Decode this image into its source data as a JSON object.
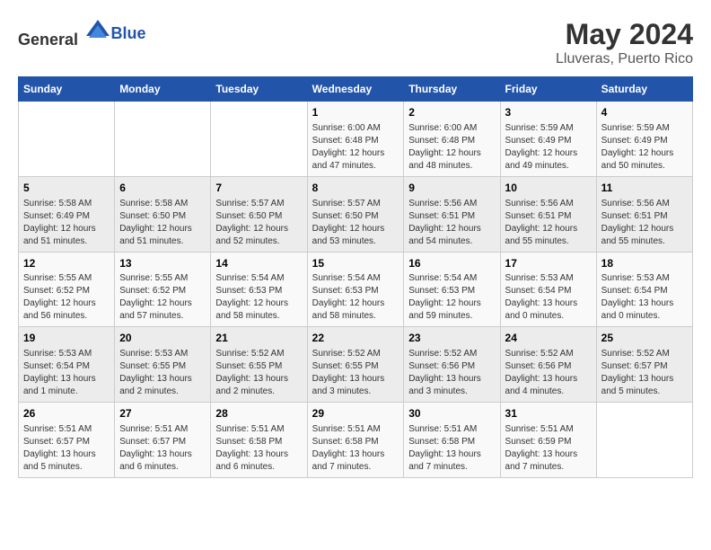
{
  "logo": {
    "general": "General",
    "blue": "Blue"
  },
  "title": "May 2024",
  "subtitle": "Lluveras, Puerto Rico",
  "weekdays": [
    "Sunday",
    "Monday",
    "Tuesday",
    "Wednesday",
    "Thursday",
    "Friday",
    "Saturday"
  ],
  "weeks": [
    [
      {
        "day": "",
        "info": ""
      },
      {
        "day": "",
        "info": ""
      },
      {
        "day": "",
        "info": ""
      },
      {
        "day": "1",
        "info": "Sunrise: 6:00 AM\nSunset: 6:48 PM\nDaylight: 12 hours and 47 minutes."
      },
      {
        "day": "2",
        "info": "Sunrise: 6:00 AM\nSunset: 6:48 PM\nDaylight: 12 hours and 48 minutes."
      },
      {
        "day": "3",
        "info": "Sunrise: 5:59 AM\nSunset: 6:49 PM\nDaylight: 12 hours and 49 minutes."
      },
      {
        "day": "4",
        "info": "Sunrise: 5:59 AM\nSunset: 6:49 PM\nDaylight: 12 hours and 50 minutes."
      }
    ],
    [
      {
        "day": "5",
        "info": "Sunrise: 5:58 AM\nSunset: 6:49 PM\nDaylight: 12 hours and 51 minutes."
      },
      {
        "day": "6",
        "info": "Sunrise: 5:58 AM\nSunset: 6:50 PM\nDaylight: 12 hours and 51 minutes."
      },
      {
        "day": "7",
        "info": "Sunrise: 5:57 AM\nSunset: 6:50 PM\nDaylight: 12 hours and 52 minutes."
      },
      {
        "day": "8",
        "info": "Sunrise: 5:57 AM\nSunset: 6:50 PM\nDaylight: 12 hours and 53 minutes."
      },
      {
        "day": "9",
        "info": "Sunrise: 5:56 AM\nSunset: 6:51 PM\nDaylight: 12 hours and 54 minutes."
      },
      {
        "day": "10",
        "info": "Sunrise: 5:56 AM\nSunset: 6:51 PM\nDaylight: 12 hours and 55 minutes."
      },
      {
        "day": "11",
        "info": "Sunrise: 5:56 AM\nSunset: 6:51 PM\nDaylight: 12 hours and 55 minutes."
      }
    ],
    [
      {
        "day": "12",
        "info": "Sunrise: 5:55 AM\nSunset: 6:52 PM\nDaylight: 12 hours and 56 minutes."
      },
      {
        "day": "13",
        "info": "Sunrise: 5:55 AM\nSunset: 6:52 PM\nDaylight: 12 hours and 57 minutes."
      },
      {
        "day": "14",
        "info": "Sunrise: 5:54 AM\nSunset: 6:53 PM\nDaylight: 12 hours and 58 minutes."
      },
      {
        "day": "15",
        "info": "Sunrise: 5:54 AM\nSunset: 6:53 PM\nDaylight: 12 hours and 58 minutes."
      },
      {
        "day": "16",
        "info": "Sunrise: 5:54 AM\nSunset: 6:53 PM\nDaylight: 12 hours and 59 minutes."
      },
      {
        "day": "17",
        "info": "Sunrise: 5:53 AM\nSunset: 6:54 PM\nDaylight: 13 hours and 0 minutes."
      },
      {
        "day": "18",
        "info": "Sunrise: 5:53 AM\nSunset: 6:54 PM\nDaylight: 13 hours and 0 minutes."
      }
    ],
    [
      {
        "day": "19",
        "info": "Sunrise: 5:53 AM\nSunset: 6:54 PM\nDaylight: 13 hours and 1 minute."
      },
      {
        "day": "20",
        "info": "Sunrise: 5:53 AM\nSunset: 6:55 PM\nDaylight: 13 hours and 2 minutes."
      },
      {
        "day": "21",
        "info": "Sunrise: 5:52 AM\nSunset: 6:55 PM\nDaylight: 13 hours and 2 minutes."
      },
      {
        "day": "22",
        "info": "Sunrise: 5:52 AM\nSunset: 6:55 PM\nDaylight: 13 hours and 3 minutes."
      },
      {
        "day": "23",
        "info": "Sunrise: 5:52 AM\nSunset: 6:56 PM\nDaylight: 13 hours and 3 minutes."
      },
      {
        "day": "24",
        "info": "Sunrise: 5:52 AM\nSunset: 6:56 PM\nDaylight: 13 hours and 4 minutes."
      },
      {
        "day": "25",
        "info": "Sunrise: 5:52 AM\nSunset: 6:57 PM\nDaylight: 13 hours and 5 minutes."
      }
    ],
    [
      {
        "day": "26",
        "info": "Sunrise: 5:51 AM\nSunset: 6:57 PM\nDaylight: 13 hours and 5 minutes."
      },
      {
        "day": "27",
        "info": "Sunrise: 5:51 AM\nSunset: 6:57 PM\nDaylight: 13 hours and 6 minutes."
      },
      {
        "day": "28",
        "info": "Sunrise: 5:51 AM\nSunset: 6:58 PM\nDaylight: 13 hours and 6 minutes."
      },
      {
        "day": "29",
        "info": "Sunrise: 5:51 AM\nSunset: 6:58 PM\nDaylight: 13 hours and 7 minutes."
      },
      {
        "day": "30",
        "info": "Sunrise: 5:51 AM\nSunset: 6:58 PM\nDaylight: 13 hours and 7 minutes."
      },
      {
        "day": "31",
        "info": "Sunrise: 5:51 AM\nSunset: 6:59 PM\nDaylight: 13 hours and 7 minutes."
      },
      {
        "day": "",
        "info": ""
      }
    ]
  ]
}
